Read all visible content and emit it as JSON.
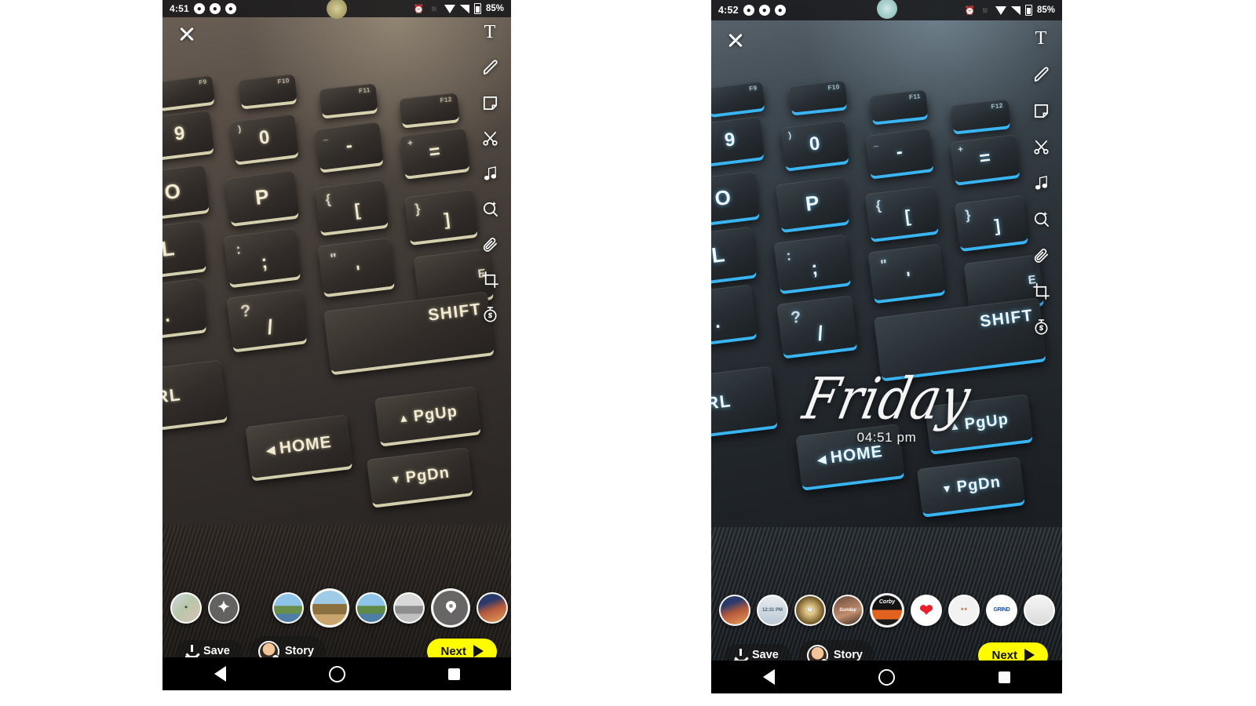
{
  "screens": [
    {
      "id": "left",
      "status_bar": {
        "time": "4:51",
        "messenger_badges": 3,
        "icons": [
          "alarm-icon",
          "vibrate-icon",
          "wifi-icon",
          "signal-off-icon",
          "battery-icon"
        ],
        "battery": "85%"
      },
      "close_label": "✕",
      "toolbar": [
        {
          "name": "text-tool",
          "glyph": "T",
          "label": "Text"
        },
        {
          "name": "draw-tool",
          "glyph": "pencil",
          "label": "Draw"
        },
        {
          "name": "sticker-tool",
          "glyph": "sticker",
          "label": "Sticker"
        },
        {
          "name": "scissors-tool",
          "glyph": "scissors",
          "label": "Scissors"
        },
        {
          "name": "music-tool",
          "glyph": "music-note",
          "label": "Music"
        },
        {
          "name": "lens-tool",
          "glyph": "magic-timer",
          "label": "Lens"
        },
        {
          "name": "attachment-tool",
          "glyph": "paperclip",
          "label": "Attach Link"
        },
        {
          "name": "crop-tool",
          "glyph": "crop",
          "label": "Crop"
        },
        {
          "name": "timer-tool",
          "glyph": "stopwatch",
          "label": "Timer"
        }
      ],
      "overlay": null,
      "filters": [
        {
          "name": "filter-logo",
          "type": "image",
          "label": "",
          "selected": false
        },
        {
          "name": "filter-magic",
          "type": "sparkle",
          "label": "",
          "selected": false
        },
        {
          "name": "filter-scenic-1",
          "type": "scenic",
          "label": "",
          "selected": false,
          "gap": true
        },
        {
          "name": "filter-scenic-2",
          "type": "scenic",
          "label": "",
          "selected": false
        },
        {
          "name": "filter-scenic-3",
          "type": "scenic",
          "label": "",
          "selected": false
        },
        {
          "name": "filter-scenic-bw",
          "type": "scenic-bw",
          "label": "",
          "selected": false
        },
        {
          "name": "filter-location-pin",
          "type": "pin",
          "label": "",
          "selected": true
        },
        {
          "name": "filter-sunset",
          "type": "sunset",
          "label": "",
          "selected": false
        }
      ],
      "actions": {
        "save_label": "Save",
        "story_label": "Story",
        "next_label": "Next"
      },
      "nav": [
        "back-button",
        "home-button",
        "recents-button"
      ],
      "photo": {
        "subject": "backlit gaming laptop keyboard",
        "backlight_color": "#f5eec8",
        "tone": "warm sepia",
        "keys": [
          {
            "label": "9",
            "sub": "(",
            "fn": ""
          },
          {
            "label": "0",
            "sub": ")",
            "fn": ""
          },
          {
            "label": "-",
            "sub": "_",
            "fn": ""
          },
          {
            "label": "=",
            "sub": "+",
            "fn": ""
          },
          {
            "label": "O",
            "sub": "",
            "fn": ""
          },
          {
            "label": "P",
            "sub": "",
            "fn": ""
          },
          {
            "label": "[",
            "sub": "{",
            "fn": ""
          },
          {
            "label": "]",
            "sub": "}",
            "fn": ""
          },
          {
            "label": "L",
            "sub": "",
            "fn": ""
          },
          {
            "label": ";",
            "sub": ":",
            "fn": ""
          },
          {
            "label": "'",
            "sub": "\"",
            "fn": ""
          },
          {
            "label": ".",
            "sub": ">",
            "fn": ""
          },
          {
            "label": "/",
            "sub": "?",
            "fn": ""
          },
          {
            "label": "SHIFT",
            "sub": "",
            "fn": ""
          },
          {
            "label": "CTRL",
            "sub": "",
            "fn": ""
          },
          {
            "label": "HOME",
            "sub": "",
            "fn": ""
          },
          {
            "label": "PgUp",
            "sub": "",
            "fn": ""
          },
          {
            "label": "PgDn",
            "sub": "",
            "fn": ""
          },
          {
            "label": "F9",
            "sub": "",
            "fn": "F9"
          },
          {
            "label": "F10",
            "sub": "",
            "fn": "F10"
          },
          {
            "label": "F11",
            "sub": "",
            "fn": "F11"
          },
          {
            "label": "F12",
            "sub": "",
            "fn": "F12"
          }
        ]
      }
    },
    {
      "id": "right",
      "status_bar": {
        "time": "4:52",
        "messenger_badges": 3,
        "icons": [
          "alarm-icon",
          "vibrate-icon",
          "wifi-icon",
          "signal-off-icon",
          "battery-icon"
        ],
        "battery": "85%"
      },
      "close_label": "✕",
      "toolbar": [
        {
          "name": "text-tool",
          "glyph": "T",
          "label": "Text"
        },
        {
          "name": "draw-tool",
          "glyph": "pencil",
          "label": "Draw"
        },
        {
          "name": "sticker-tool",
          "glyph": "sticker",
          "label": "Sticker"
        },
        {
          "name": "scissors-tool",
          "glyph": "scissors",
          "label": "Scissors"
        },
        {
          "name": "music-tool",
          "glyph": "music-note",
          "label": "Music"
        },
        {
          "name": "lens-tool",
          "glyph": "magic-timer",
          "label": "Lens"
        },
        {
          "name": "attachment-tool",
          "glyph": "paperclip",
          "label": "Attach Link"
        },
        {
          "name": "crop-tool",
          "glyph": "crop",
          "label": "Crop"
        },
        {
          "name": "timer-tool",
          "glyph": "stopwatch",
          "label": "Timer"
        }
      ],
      "overlay": {
        "day": "Friday",
        "time": "04:51 pm"
      },
      "filters": [
        {
          "name": "filter-sunset",
          "type": "sunset",
          "label": "",
          "selected": false
        },
        {
          "name": "filter-time-stamp",
          "type": "time",
          "label": "12:31 PM",
          "selected": false
        },
        {
          "name": "filter-clock",
          "type": "clock",
          "label": "",
          "selected": false
        },
        {
          "name": "filter-sunday",
          "type": "script",
          "label": "Sunday",
          "selected": false
        },
        {
          "name": "filter-geofilter-corby",
          "type": "geofilter",
          "label": "Corby",
          "selected": true
        },
        {
          "name": "filter-heart",
          "type": "heart",
          "label": "",
          "selected": false
        },
        {
          "name": "filter-wording",
          "type": "wording",
          "label": "",
          "selected": false
        },
        {
          "name": "filter-grind",
          "type": "grind",
          "label": "GRIND",
          "selected": false
        },
        {
          "name": "filter-plain",
          "type": "plain",
          "label": "",
          "selected": false
        }
      ],
      "actions": {
        "save_label": "Save",
        "story_label": "Story",
        "next_label": "Next"
      },
      "nav": [
        "back-button",
        "home-button",
        "recents-button"
      ],
      "photo": {
        "subject": "backlit gaming laptop keyboard",
        "backlight_color": "#3cbeff",
        "tone": "cool blue",
        "keys": [
          {
            "label": "9",
            "sub": "(",
            "fn": ""
          },
          {
            "label": "0",
            "sub": ")",
            "fn": ""
          },
          {
            "label": "-",
            "sub": "_",
            "fn": ""
          },
          {
            "label": "=",
            "sub": "+",
            "fn": ""
          },
          {
            "label": "O",
            "sub": "",
            "fn": ""
          },
          {
            "label": "P",
            "sub": "",
            "fn": ""
          },
          {
            "label": "[",
            "sub": "{",
            "fn": ""
          },
          {
            "label": "]",
            "sub": "}",
            "fn": ""
          },
          {
            "label": "L",
            "sub": "",
            "fn": ""
          },
          {
            "label": ";",
            "sub": ":",
            "fn": ""
          },
          {
            "label": "'",
            "sub": "\"",
            "fn": ""
          },
          {
            "label": ".",
            "sub": ">",
            "fn": ""
          },
          {
            "label": "/",
            "sub": "?",
            "fn": ""
          },
          {
            "label": "SHIFT",
            "sub": "",
            "fn": ""
          },
          {
            "label": "CTRL",
            "sub": "",
            "fn": ""
          },
          {
            "label": "HOME",
            "sub": "",
            "fn": ""
          },
          {
            "label": "PgUp",
            "sub": "",
            "fn": ""
          },
          {
            "label": "PgDn",
            "sub": "",
            "fn": ""
          },
          {
            "label": "F9",
            "sub": "",
            "fn": "F9"
          },
          {
            "label": "F10",
            "sub": "",
            "fn": "F10"
          },
          {
            "label": "F11",
            "sub": "",
            "fn": "F11"
          },
          {
            "label": "F12",
            "sub": "",
            "fn": "F12"
          }
        ]
      }
    }
  ]
}
